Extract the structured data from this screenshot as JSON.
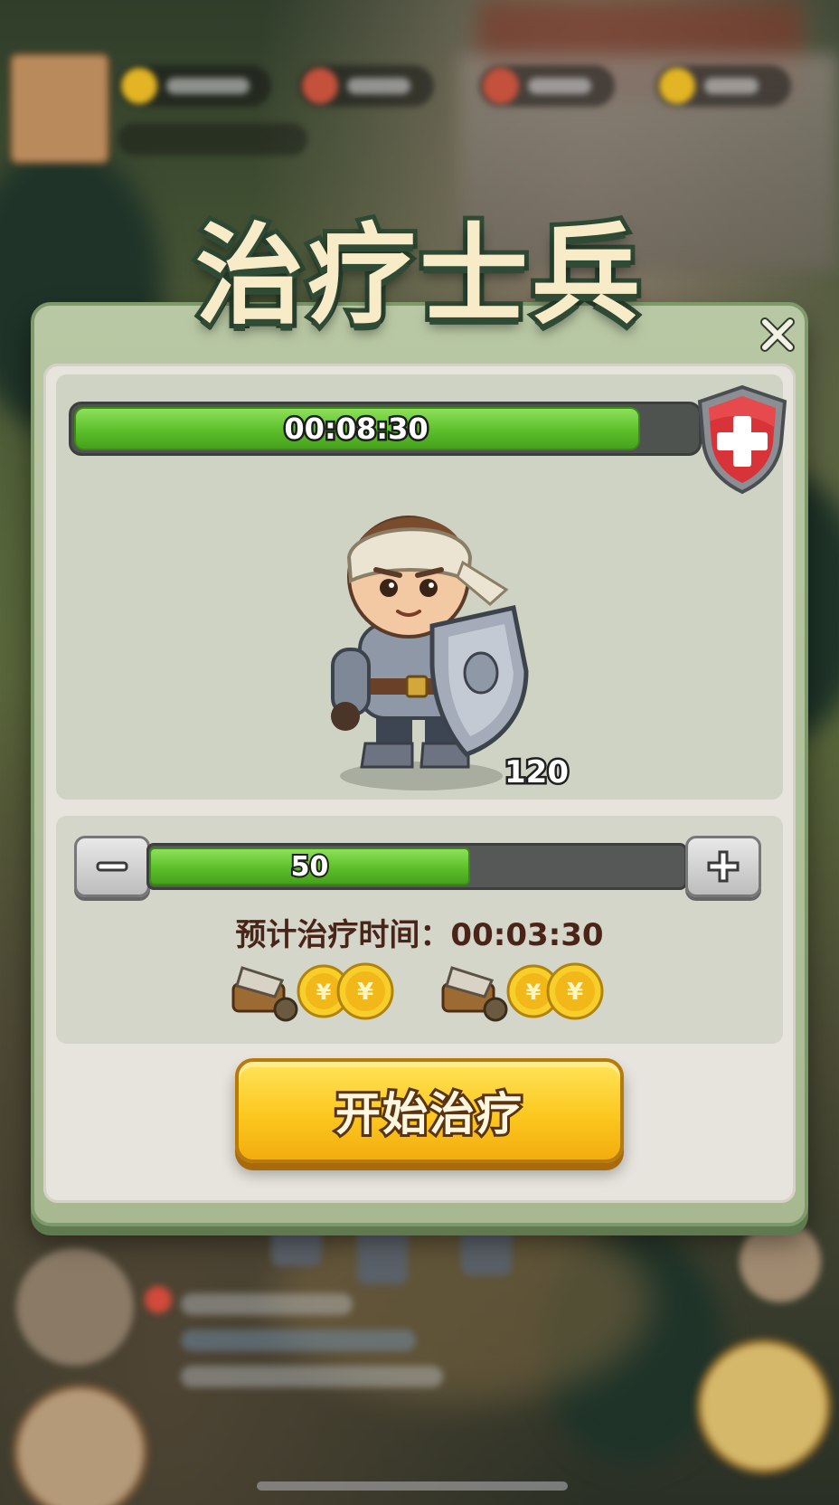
{
  "dialog": {
    "title": "治疗士兵",
    "close_icon": "close-icon"
  },
  "timer": {
    "text": "00:08:30",
    "progress": 0.85,
    "badge_icon": "medical-shield-icon"
  },
  "soldier": {
    "icon": "bandaged-knight-soldier",
    "count": "120"
  },
  "quantity": {
    "value": "50",
    "progress": 0.6,
    "minus_label": "−",
    "plus_label": "+"
  },
  "eta": {
    "text": "预计治疗时间：00:03:30"
  },
  "costs": [
    {
      "icons": [
        "wood-bucket-icon",
        "gold-coin-icon",
        "gold-coin-icon"
      ]
    },
    {
      "icons": [
        "wood-bucket-icon",
        "gold-coin-icon",
        "gold-coin-icon"
      ]
    }
  ],
  "start_button": {
    "label": "开始治疗"
  },
  "colors": {
    "accent_green": "#5cbf2a",
    "button_yellow": "#fcc81f",
    "title_fill": "#f7ebc8",
    "title_stroke": "#2f4a35",
    "eta_text": "#4a2418"
  }
}
